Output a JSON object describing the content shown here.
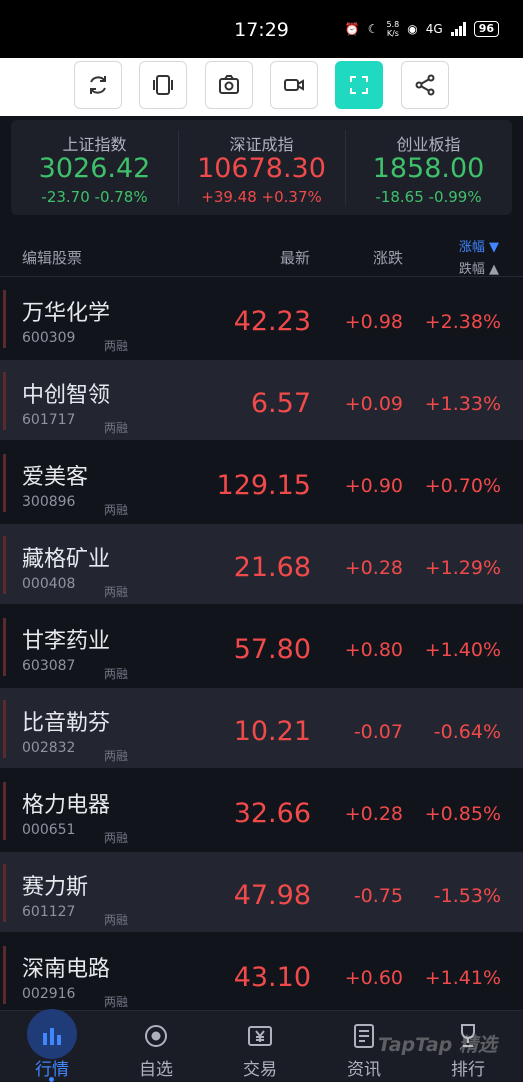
{
  "status": {
    "time": "17:29",
    "speed_top": "5.8",
    "speed_bottom": "K/s",
    "network": "4G",
    "battery": "96"
  },
  "index": [
    {
      "name": "上证指数",
      "value": "3026.42",
      "change": "-23.70  -0.78%",
      "trend": "down"
    },
    {
      "name": "深证成指",
      "value": "10678.30",
      "change": "+39.48  +0.37%",
      "trend": "up"
    },
    {
      "name": "创业板指",
      "value": "1858.00",
      "change": "-18.65  -0.99%",
      "trend": "down"
    }
  ],
  "header": {
    "edit": "编辑股票",
    "latest": "最新",
    "change": "涨跌",
    "sort_up": "涨幅 ▼",
    "sort_down": "跌幅 ▲"
  },
  "stocks": [
    {
      "name": "万华化学",
      "code": "600309",
      "tag": "两融",
      "price": "42.23",
      "chg": "+0.98",
      "pct": "+2.38%"
    },
    {
      "name": "中创智领",
      "code": "601717",
      "tag": "两融",
      "price": "6.57",
      "chg": "+0.09",
      "pct": "+1.33%"
    },
    {
      "name": "爱美客",
      "code": "300896",
      "tag": "两融",
      "price": "129.15",
      "chg": "+0.90",
      "pct": "+0.70%"
    },
    {
      "name": "藏格矿业",
      "code": "000408",
      "tag": "两融",
      "price": "21.68",
      "chg": "+0.28",
      "pct": "+1.29%"
    },
    {
      "name": "甘李药业",
      "code": "603087",
      "tag": "两融",
      "price": "57.80",
      "chg": "+0.80",
      "pct": "+1.40%"
    },
    {
      "name": "比音勒芬",
      "code": "002832",
      "tag": "两融",
      "price": "10.21",
      "chg": "-0.07",
      "pct": "-0.64%"
    },
    {
      "name": "格力电器",
      "code": "000651",
      "tag": "两融",
      "price": "32.66",
      "chg": "+0.28",
      "pct": "+0.85%"
    },
    {
      "name": "赛力斯",
      "code": "601127",
      "tag": "两融",
      "price": "47.98",
      "chg": "-0.75",
      "pct": "-1.53%"
    },
    {
      "name": "深南电路",
      "code": "002916",
      "tag": "两融",
      "price": "43.10",
      "chg": "+0.60",
      "pct": "+1.41%"
    }
  ],
  "toolbar": {
    "buttons": [
      "refresh-icon",
      "layers-icon",
      "camera-icon",
      "video-icon",
      "fullscreen-icon",
      "share-icon"
    ],
    "active_color": "#1fd9c0"
  },
  "nav": [
    {
      "label": "行情",
      "icon": "bar-chart-icon"
    },
    {
      "label": "自选",
      "icon": "target-icon"
    },
    {
      "label": "交易",
      "icon": "yuan-icon"
    },
    {
      "label": "资讯",
      "icon": "document-icon"
    },
    {
      "label": "排行",
      "icon": "trophy-icon"
    }
  ],
  "watermark": "TapTap 精选",
  "colors": {
    "up": "#f04a4a",
    "down": "#3fc06a",
    "accent": "#3f86ff",
    "background": "#12141c"
  }
}
